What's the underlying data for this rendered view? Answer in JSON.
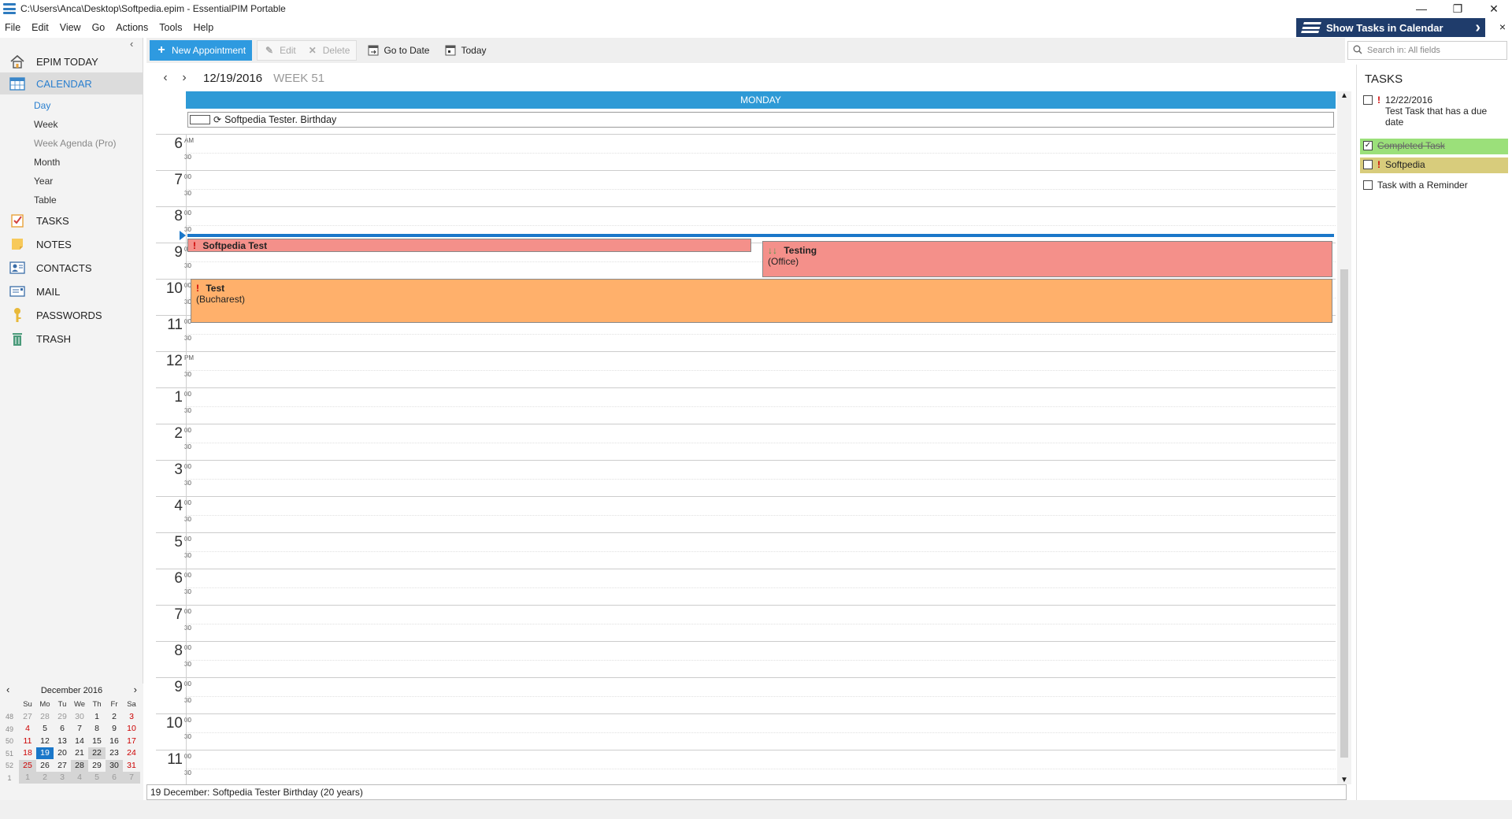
{
  "window": {
    "title": "C:\\Users\\Anca\\Desktop\\Softpedia.epim - EssentialPIM Portable",
    "controls": [
      "—",
      "❐",
      "✕"
    ]
  },
  "menu": [
    "File",
    "Edit",
    "View",
    "Go",
    "Actions",
    "Tools",
    "Help"
  ],
  "show_tasks": {
    "label": "Show Tasks in Calendar",
    "close": "×"
  },
  "sidebar": {
    "items": [
      {
        "label": "EPIM TODAY"
      },
      {
        "label": "CALENDAR"
      },
      {
        "label": "TASKS"
      },
      {
        "label": "NOTES"
      },
      {
        "label": "CONTACTS"
      },
      {
        "label": "MAIL"
      },
      {
        "label": "PASSWORDS"
      },
      {
        "label": "TRASH"
      }
    ],
    "calendar_views": [
      "Day",
      "Week",
      "Week Agenda (Pro)",
      "Month",
      "Year",
      "Table"
    ]
  },
  "toolbar": {
    "new_appointment": "New Appointment",
    "edit": "Edit",
    "delete": "Delete",
    "go_to_date": "Go to Date",
    "today": "Today"
  },
  "search": {
    "placeholder": "Search in: All fields"
  },
  "day_view": {
    "date": "12/19/2016",
    "week": "WEEK 51",
    "day_name": "MONDAY",
    "all_day_event": "Softpedia  Tester. Birthday",
    "hours": [
      {
        "h": "6",
        "sup": "AM"
      },
      {
        "h": "7",
        "sup": "00"
      },
      {
        "h": "8",
        "sup": "00"
      },
      {
        "h": "9",
        "sup": "00"
      },
      {
        "h": "10",
        "sup": "00"
      },
      {
        "h": "11",
        "sup": "00"
      },
      {
        "h": "12",
        "sup": "PM"
      },
      {
        "h": "1",
        "sup": "00"
      },
      {
        "h": "2",
        "sup": "00"
      },
      {
        "h": "3",
        "sup": "00"
      },
      {
        "h": "4",
        "sup": "00"
      },
      {
        "h": "5",
        "sup": "00"
      },
      {
        "h": "6",
        "sup": "00"
      },
      {
        "h": "7",
        "sup": "00"
      },
      {
        "h": "8",
        "sup": "00"
      },
      {
        "h": "9",
        "sup": "00"
      },
      {
        "h": "10",
        "sup": "00"
      },
      {
        "h": "11",
        "sup": "00"
      }
    ],
    "half_label": "30",
    "appointments": [
      {
        "title": "Softpedia Test",
        "location": "",
        "color": "#f4908a"
      },
      {
        "title": "Testing",
        "location": "(Office)",
        "color": "#f4908a"
      },
      {
        "title": "Test",
        "location": "(Bucharest)",
        "color": "#ffb06b"
      }
    ]
  },
  "minical": {
    "month": "December  2016",
    "dow": [
      "Su",
      "Mo",
      "Tu",
      "We",
      "Th",
      "Fr",
      "Sa"
    ],
    "weeks": [
      {
        "wk": "48",
        "days": [
          "27",
          "28",
          "29",
          "30",
          "1",
          "2",
          "3"
        ]
      },
      {
        "wk": "49",
        "days": [
          "4",
          "5",
          "6",
          "7",
          "8",
          "9",
          "10"
        ]
      },
      {
        "wk": "50",
        "days": [
          "11",
          "12",
          "13",
          "14",
          "15",
          "16",
          "17"
        ]
      },
      {
        "wk": "51",
        "days": [
          "18",
          "19",
          "20",
          "21",
          "22",
          "23",
          "24"
        ]
      },
      {
        "wk": "52",
        "days": [
          "25",
          "26",
          "27",
          "28",
          "29",
          "30",
          "31"
        ]
      },
      {
        "wk": "1",
        "days": [
          "1",
          "2",
          "3",
          "4",
          "5",
          "6",
          "7"
        ]
      }
    ]
  },
  "tasks_pane": {
    "title": "TASKS",
    "items": [
      {
        "date": "12/22/2016",
        "text": "Test Task that has a due date",
        "high": true
      },
      {
        "text": "Completed Task",
        "done": true,
        "color": "#9be07a"
      },
      {
        "text": "Softpedia",
        "high": true,
        "color": "#d8cc7c"
      },
      {
        "text": "Task with a Reminder"
      }
    ]
  },
  "status": {
    "text": "19 December:  Softpedia  Tester Birthday  (20 years)"
  },
  "colors": {
    "accent": "#2e9ad6",
    "today": "#1a77c9",
    "high_priority": "#cc0000"
  }
}
